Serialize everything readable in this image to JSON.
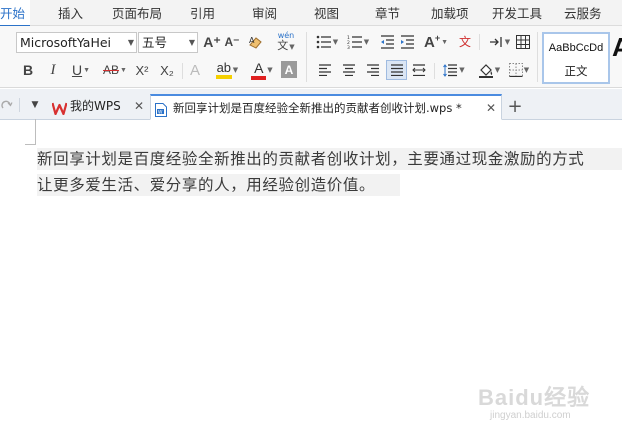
{
  "menu": {
    "items": [
      "开始",
      "插入",
      "页面布局",
      "引用",
      "审阅",
      "视图",
      "章节",
      "加载项",
      "开发工具",
      "云服务"
    ]
  },
  "ribbon": {
    "font_name": "MicrosoftYaHei",
    "font_size": "五号",
    "style_sample": "AaBbCcDd",
    "style_name": "正文",
    "style_next_sample": "A",
    "icons": {
      "bold": "B",
      "italic": "I",
      "underline": "U",
      "strikethrough": "AB",
      "superscript": "X²",
      "subscript": "X₂",
      "font_color": "A",
      "grow_font": "A⁺",
      "shrink_font": "A⁻",
      "phonetic": "wén"
    },
    "colors": {
      "highlight": "#f5d000",
      "font_color": "#e02020",
      "accent": "#2b72c8"
    }
  },
  "tabs": [
    {
      "label": "我的WPS",
      "icon": "wps-logo-icon"
    },
    {
      "label": "新回享计划是百度经验全新推出的贡献者创收计划.wps *",
      "icon": "word-doc-icon"
    }
  ],
  "document": {
    "lines": [
      "新回享计划是百度经验全新推出的贡献者创收计划，主要通过现金激励的方式",
      "让更多爱生活、爱分享的人，用经验创造价值。"
    ]
  },
  "watermark": {
    "text": "Baidu经验",
    "url": "jingyan.baidu.com"
  }
}
